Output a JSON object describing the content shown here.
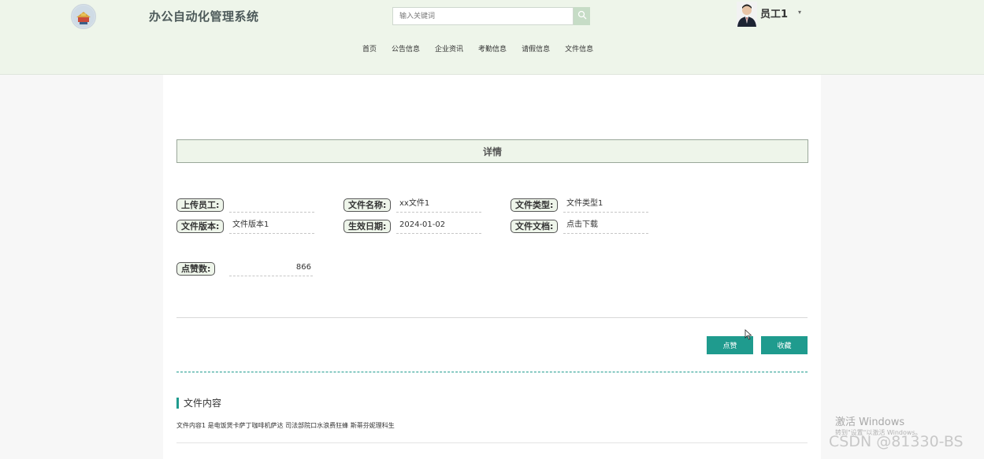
{
  "header": {
    "logo_icon": "emblem-logo-icon",
    "app_title": "办公自动化管理系统",
    "search": {
      "placeholder": "输入关键词",
      "value": "",
      "button_icon": "search-icon"
    },
    "user": {
      "name": "员工1",
      "avatar_icon": "user-avatar",
      "caret_icon": "chevron-down-icon"
    },
    "nav": [
      "首页",
      "公告信息",
      "企业资讯",
      "考勤信息",
      "请假信息",
      "文件信息"
    ]
  },
  "detail": {
    "section_header": "详情",
    "fields": {
      "uploader": {
        "label": "上传员工:",
        "value": ""
      },
      "file_name": {
        "label": "文件名称:",
        "value": "xx文件1"
      },
      "file_type": {
        "label": "文件类型:",
        "value": "文件类型1"
      },
      "file_version": {
        "label": "文件版本:",
        "value": "文件版本1"
      },
      "effective_date": {
        "label": "生效日期:",
        "value": "2024-01-02"
      },
      "file_document": {
        "label": "文件文档:",
        "value": "点击下载"
      },
      "likes": {
        "label": "点赞数:",
        "value": "866"
      }
    },
    "actions": {
      "like": "点赞",
      "favorite": "收藏"
    },
    "content": {
      "title": "文件内容",
      "text": "文件内容1 是电饭煲卡萨丁咖啡机萨达 司法部院口水浪费狂蜂 斯蒂芬妮理科生"
    }
  },
  "overlays": {
    "activate_windows": "激活 Windows",
    "activate_windows_sub": "转到\"设置\"以激活 Windows。",
    "csdn_watermark": "CSDN @81330-BS"
  },
  "colors": {
    "header_bg": "#eef5ea",
    "accent": "#1f9b8e",
    "page_bg": "#f7f7f7"
  }
}
